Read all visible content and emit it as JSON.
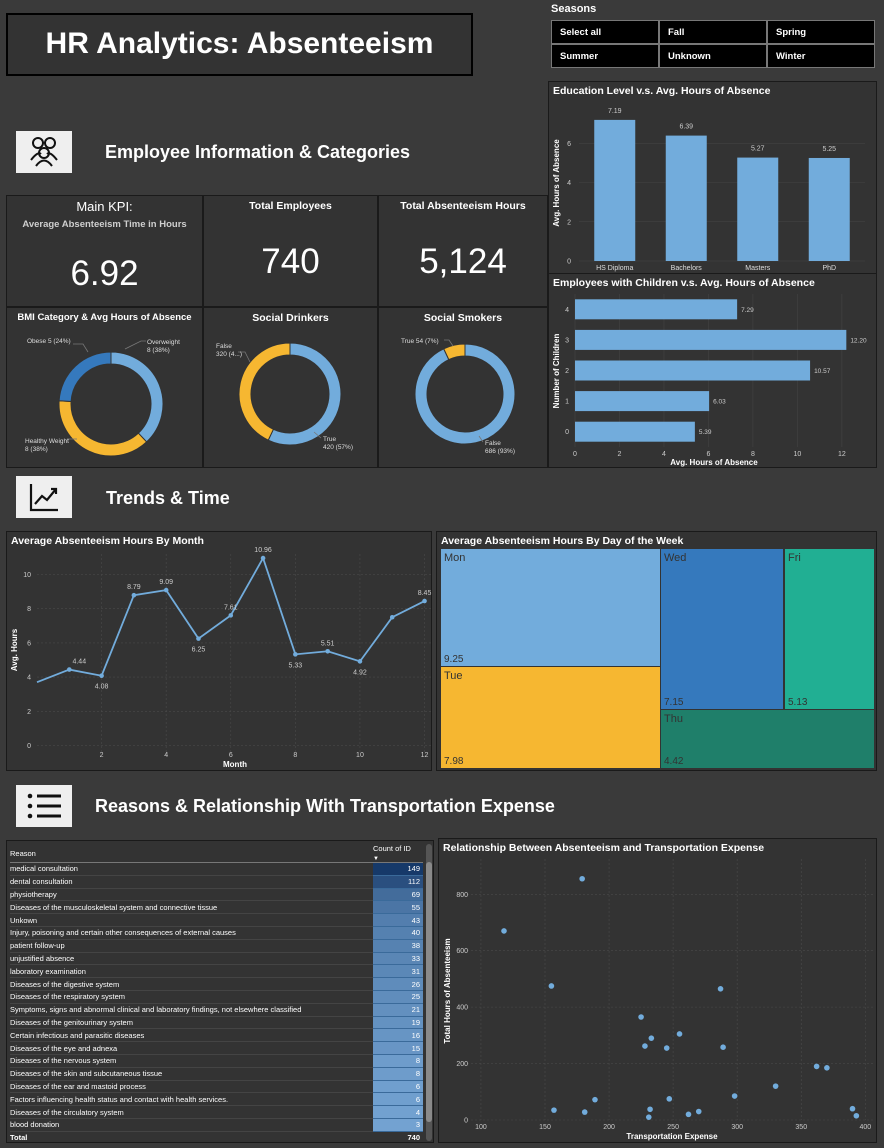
{
  "header": {
    "title": "HR Analytics: Absenteeism"
  },
  "seasons": {
    "label": "Seasons",
    "options": [
      "Select all",
      "Fall",
      "Spring",
      "Summer",
      "Unknown",
      "Winter"
    ]
  },
  "sections": {
    "employee": "Employee Information & Categories",
    "trends": "Trends & Time",
    "reasons": "Reasons & Relationship With Transportation Expense"
  },
  "kpi": {
    "main_title": "Main KPI:",
    "main_subtitle": "Average Absenteeism Time in Hours",
    "main_value": "6.92",
    "employees_title": "Total Employees",
    "employees_value": "740",
    "hours_title": "Total Absenteeism Hours",
    "hours_value": "5,124"
  },
  "colors": {
    "blue": "#72acdc",
    "yellow": "#f6b731",
    "darkblue": "#3579bd",
    "teal": "#21af93",
    "darkteal": "#1f7f6a"
  },
  "chart_data": [
    {
      "type": "pie",
      "title": "BMI Category & Avg Hours of Absence",
      "slices": [
        {
          "label": "Overweight",
          "value": 38,
          "display": "8 (38%)",
          "color": "#72acdc"
        },
        {
          "label": "Healthy Weight",
          "value": 38,
          "display": "8 (38%)",
          "color": "#f6b731"
        },
        {
          "label": "Obese",
          "value": 24,
          "display": "5 (24%)",
          "color": "#3579bd"
        }
      ]
    },
    {
      "type": "pie",
      "title": "Social Drinkers",
      "slices": [
        {
          "label": "True",
          "value": 57,
          "display": "420 (57%)",
          "color": "#72acdc"
        },
        {
          "label": "False",
          "value": 43,
          "display": "320 (4...)",
          "color": "#f6b731"
        }
      ]
    },
    {
      "type": "pie",
      "title": "Social Smokers",
      "slices": [
        {
          "label": "False",
          "value": 93,
          "display": "686 (93%)",
          "color": "#72acdc"
        },
        {
          "label": "True",
          "value": 7,
          "display": "54 (7%)",
          "color": "#f6b731"
        }
      ]
    },
    {
      "type": "bar",
      "title": "Education Level v.s. Avg. Hours of Absence",
      "categories": [
        "HS Diploma",
        "Bachelors",
        "Masters",
        "PhD"
      ],
      "values": [
        7.19,
        6.39,
        5.27,
        5.25
      ],
      "ylabel": "Avg. Hours of Absence",
      "ylim": [
        0,
        8
      ],
      "yticks": [
        0,
        2,
        4,
        6
      ]
    },
    {
      "type": "bar",
      "orientation": "horizontal",
      "title": "Employees with Children v.s. Avg. Hours of Absence",
      "categories": [
        "4",
        "3",
        "2",
        "1",
        "0"
      ],
      "values": [
        7.29,
        12.2,
        10.57,
        6.03,
        5.39
      ],
      "labels": [
        "7.29",
        "12.20",
        "10.57",
        "6.03",
        "5.39"
      ],
      "xlabel": "Avg. Hours of Absence",
      "ylabel": "Number of Children",
      "xlim": [
        0,
        12.5
      ],
      "xticks": [
        0,
        2,
        4,
        6,
        8,
        10,
        12
      ]
    },
    {
      "type": "line",
      "title": "Average Absenteeism Hours By Month",
      "x": [
        0,
        1,
        2,
        3,
        4,
        5,
        6,
        7,
        8,
        9,
        10,
        11,
        12
      ],
      "y": [
        3.7,
        4.44,
        4.08,
        8.79,
        9.09,
        6.25,
        7.61,
        10.96,
        5.33,
        5.51,
        4.92,
        7.5,
        8.45
      ],
      "labels": [
        "",
        "4.44",
        "4.08",
        "8.79",
        "9.09",
        "6.25",
        "7.61",
        "10.96",
        "5.33",
        "5.51",
        "4.92",
        "",
        "8.45"
      ],
      "xlabel": "Month",
      "ylabel": "Avg. Hours",
      "xticks": [
        2,
        4,
        6,
        8,
        10,
        12
      ],
      "yticks": [
        0,
        2,
        4,
        6,
        8,
        10
      ],
      "xlim": [
        0,
        12.2
      ],
      "ylim": [
        -0.5,
        11.2
      ]
    },
    {
      "type": "heatmap",
      "subtype": "treemap",
      "title": "Average Absenteeism Hours By Day of the Week",
      "cells": [
        {
          "label": "Mon",
          "value": "9.25",
          "color": "#72acdc"
        },
        {
          "label": "Wed",
          "value": "7.15",
          "color": "#3579bd"
        },
        {
          "label": "Fri",
          "value": "5.13",
          "color": "#21af93"
        },
        {
          "label": "Tue",
          "value": "7.98",
          "color": "#f6b731"
        },
        {
          "label": "Thu",
          "value": "4.42",
          "color": "#1f7f6a"
        }
      ]
    },
    {
      "type": "table",
      "columns": [
        "Reason",
        "Count of ID"
      ],
      "rows": [
        [
          "medical consultation",
          149
        ],
        [
          "dental consultation",
          112
        ],
        [
          "physiotherapy",
          69
        ],
        [
          "Diseases of the musculoskeletal system and connective tissue",
          55
        ],
        [
          "Unkown",
          43
        ],
        [
          "Injury, poisoning and certain other consequences of external causes",
          40
        ],
        [
          "patient follow-up",
          38
        ],
        [
          "unjustified absence",
          33
        ],
        [
          "laboratory examination",
          31
        ],
        [
          "Diseases of the digestive system",
          26
        ],
        [
          "Diseases of the respiratory system",
          25
        ],
        [
          "Symptoms, signs and abnormal clinical and laboratory findings, not elsewhere classified",
          21
        ],
        [
          "Diseases of the genitourinary system",
          19
        ],
        [
          "Certain infectious and parasitic diseases",
          16
        ],
        [
          "Diseases of the eye and adnexa",
          15
        ],
        [
          "Diseases of the nervous system",
          8
        ],
        [
          "Diseases of the skin and subcutaneous tissue",
          8
        ],
        [
          "Diseases of the ear and mastoid process",
          6
        ],
        [
          "Factors influencing health status and contact with health services.",
          6
        ],
        [
          "Diseases of the circulatory system",
          4
        ],
        [
          "blood donation",
          3
        ]
      ],
      "total_label": "Total",
      "total_value": 740
    },
    {
      "type": "scatter",
      "title": "Relationship Between Absenteeism and Transportation Expense",
      "xlabel": "Transportation Expense",
      "ylabel": "Total Hours of Absenteeism",
      "xticks": [
        100,
        150,
        200,
        250,
        300,
        350,
        400
      ],
      "yticks": [
        0,
        200,
        400,
        600,
        800
      ],
      "xlim": [
        86,
        406
      ],
      "ylim": [
        0,
        925
      ],
      "points": [
        [
          118,
          670
        ],
        [
          155,
          475
        ],
        [
          157,
          35
        ],
        [
          179,
          855
        ],
        [
          181,
          28
        ],
        [
          189,
          72
        ],
        [
          225,
          365
        ],
        [
          228,
          262
        ],
        [
          232,
          38
        ],
        [
          233,
          290
        ],
        [
          231,
          10
        ],
        [
          245,
          255
        ],
        [
          247,
          75
        ],
        [
          255,
          305
        ],
        [
          262,
          20
        ],
        [
          270,
          30
        ],
        [
          287,
          465
        ],
        [
          289,
          258
        ],
        [
          298,
          85
        ],
        [
          330,
          120
        ],
        [
          362,
          190
        ],
        [
          370,
          185
        ],
        [
          390,
          40
        ],
        [
          393,
          15
        ]
      ]
    }
  ]
}
